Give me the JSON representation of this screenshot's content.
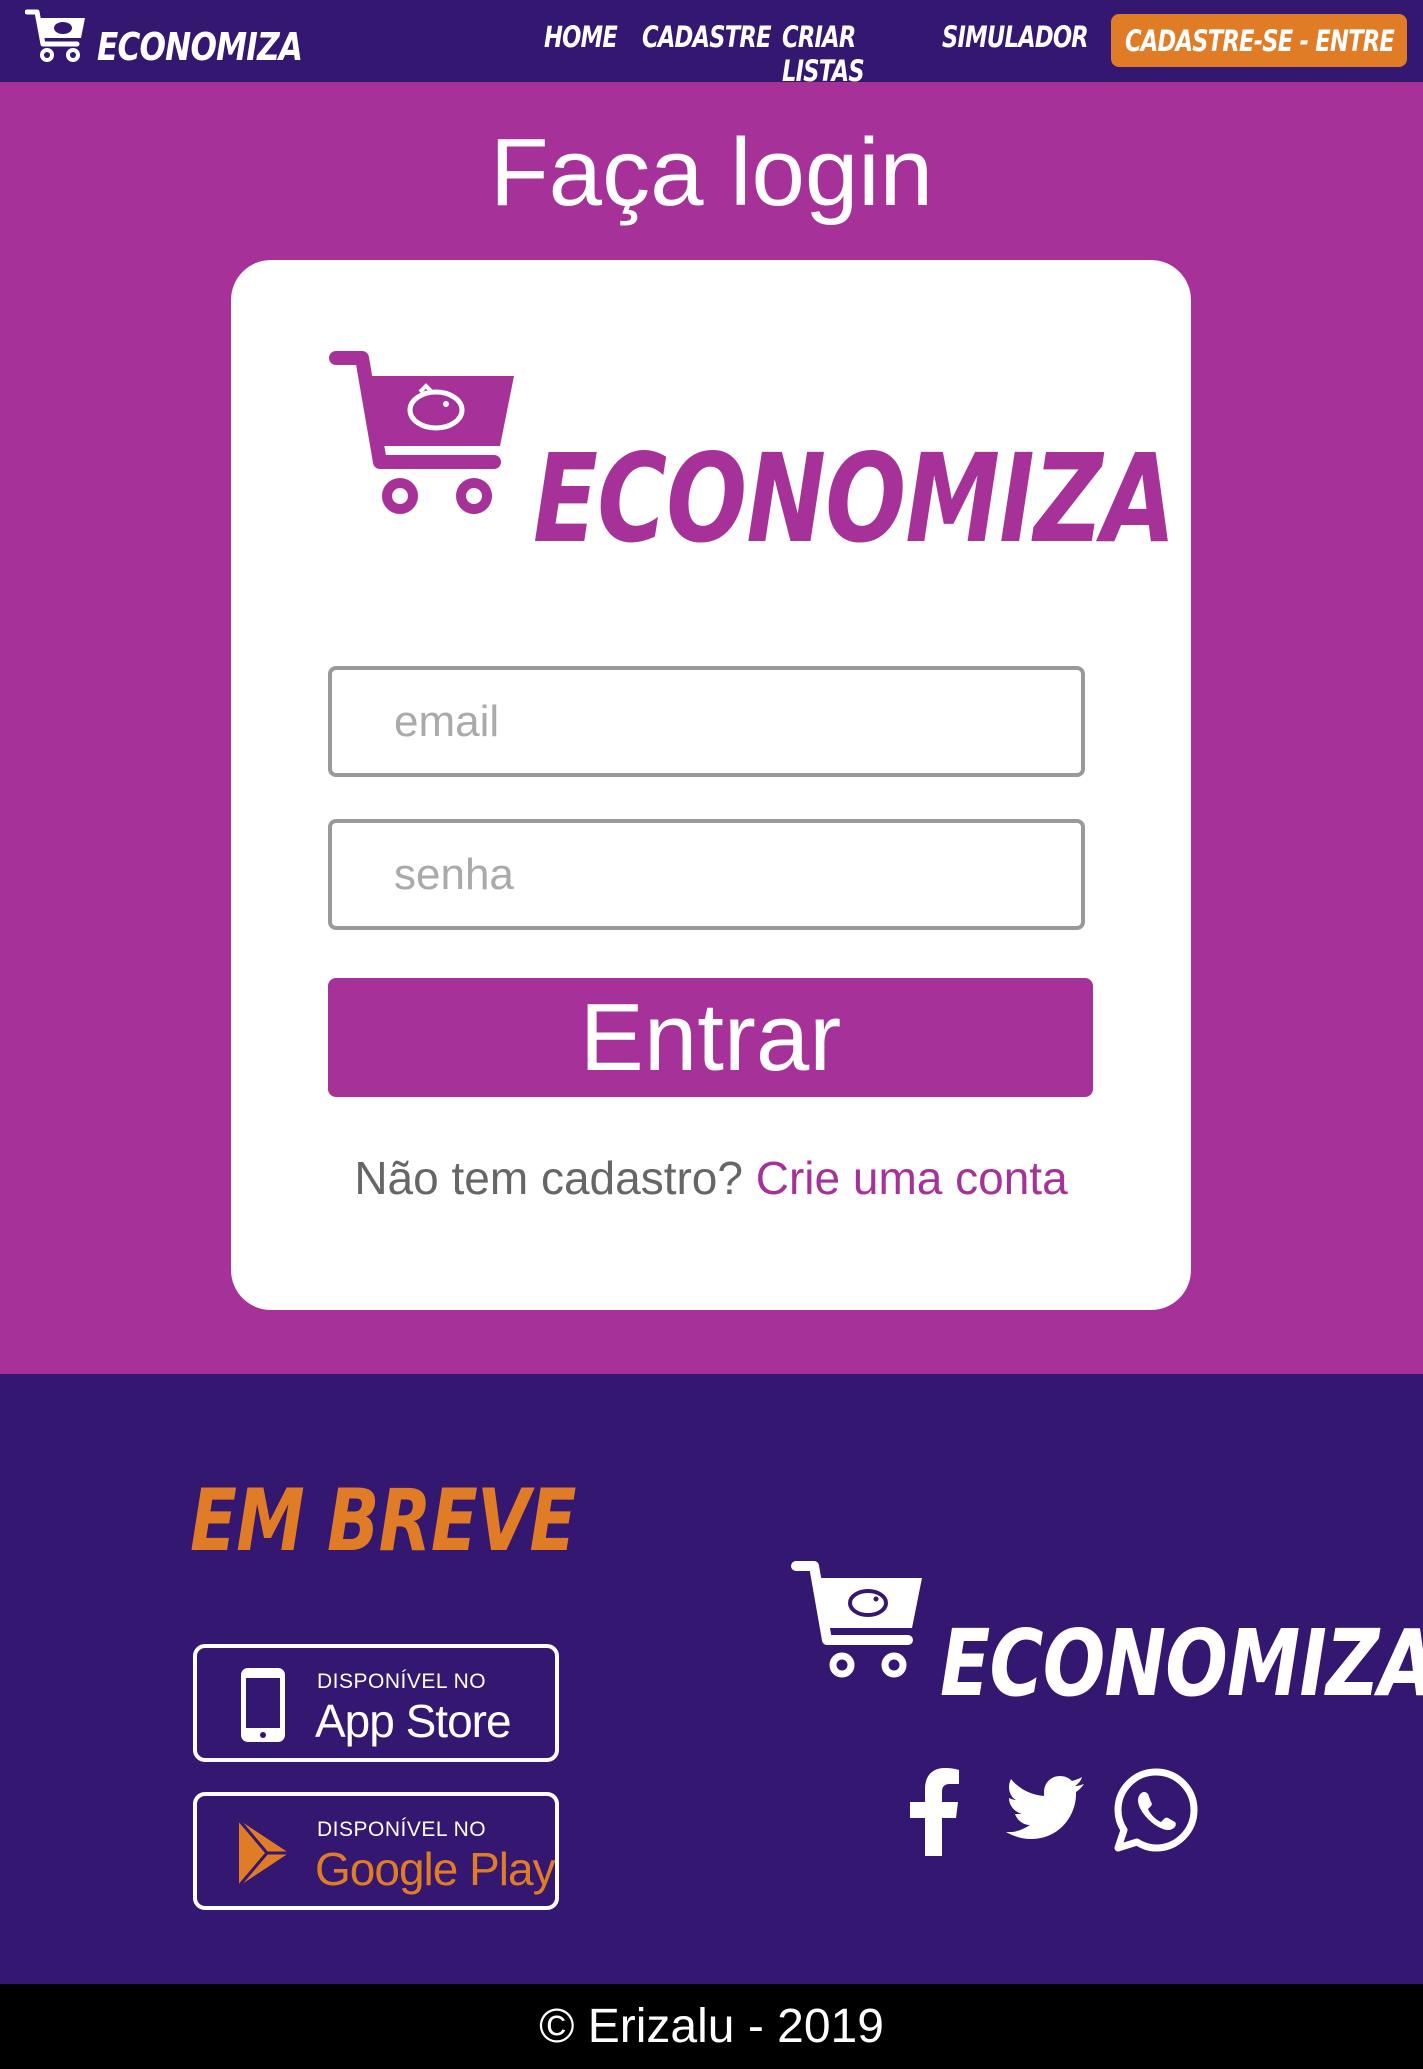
{
  "header": {
    "brand": "ECONOMIZA",
    "nav": [
      "HOME",
      "CADASTRE",
      "CRIAR LISTAS",
      "SIMULADOR"
    ],
    "cta_label": "CADASTRE-SE - ENTRE"
  },
  "main": {
    "title": "Faça login",
    "card_brand": "ECONOMIZA",
    "email_placeholder": "email",
    "password_placeholder": "senha",
    "submit_label": "Entrar",
    "signup_prompt": "Não tem cadastro?",
    "signup_link": "Crie uma conta"
  },
  "footer": {
    "soon_title": "EM BREVE",
    "app_store": {
      "small": "DISPONÍVEL NO",
      "big": "App Store"
    },
    "google_play": {
      "small": "DISPONÍVEL NO",
      "big": "Google Play"
    },
    "brand": "ECONOMIZA",
    "social_icons": [
      "facebook-icon",
      "twitter-icon",
      "whatsapp-icon"
    ],
    "copyright": "© Erizalu - 2019"
  },
  "colors": {
    "purple_dark": "#341770",
    "magenta": "#a63199",
    "orange": "#e07b26"
  }
}
